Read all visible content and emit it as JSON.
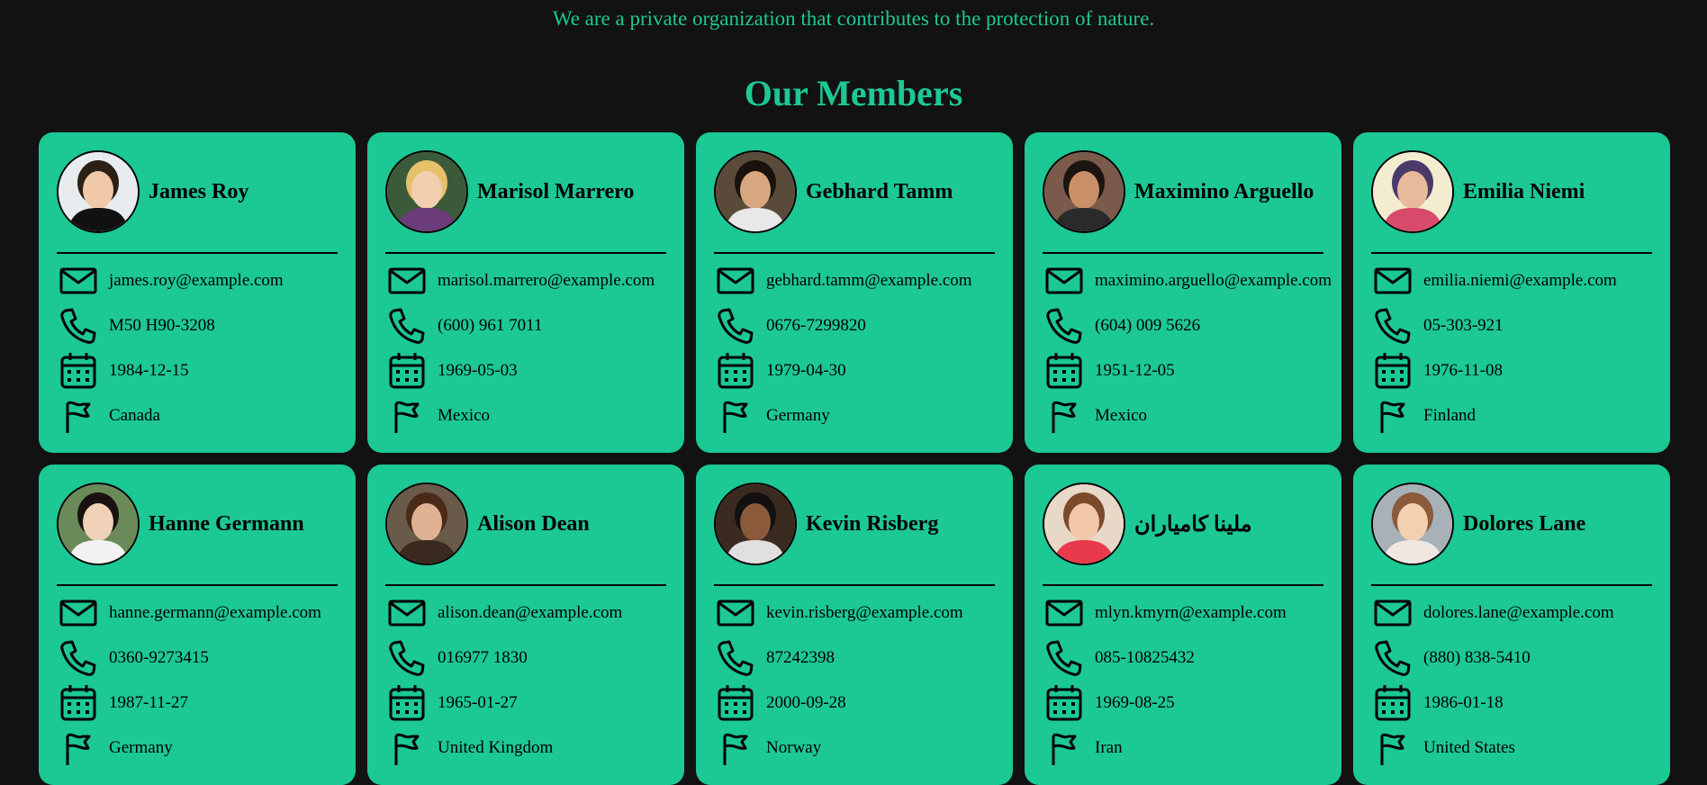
{
  "tagline": "We are a private organization that contributes to the protection of nature.",
  "heading": "Our Members",
  "colors": {
    "background": "#121212",
    "accent": "#1cc894",
    "text": "#000000"
  },
  "icons": {
    "email": "mail-icon",
    "phone": "phone-icon",
    "birthday": "calendar-icon",
    "country": "flag-icon"
  },
  "members": [
    {
      "name": "James Roy",
      "email": "james.roy@example.com",
      "phone": "M50 H90-3208",
      "birthday": "1984-12-15",
      "country": "Canada"
    },
    {
      "name": "Marisol Marrero",
      "email": "marisol.marrero@example.com",
      "phone": "(600) 961 7011",
      "birthday": "1969-05-03",
      "country": "Mexico"
    },
    {
      "name": "Gebhard Tamm",
      "email": "gebhard.tamm@example.com",
      "phone": "0676-7299820",
      "birthday": "1979-04-30",
      "country": "Germany"
    },
    {
      "name": "Maximino Arguello",
      "email": "maximino.arguello@example.com",
      "phone": "(604) 009 5626",
      "birthday": "1951-12-05",
      "country": "Mexico"
    },
    {
      "name": "Emilia Niemi",
      "email": "emilia.niemi@example.com",
      "phone": "05-303-921",
      "birthday": "1976-11-08",
      "country": "Finland"
    },
    {
      "name": "Hanne Germann",
      "email": "hanne.germann@example.com",
      "phone": "0360-9273415",
      "birthday": "1987-11-27",
      "country": "Germany"
    },
    {
      "name": "Alison Dean",
      "email": "alison.dean@example.com",
      "phone": "016977 1830",
      "birthday": "1965-01-27",
      "country": "United Kingdom"
    },
    {
      "name": "Kevin Risberg",
      "email": "kevin.risberg@example.com",
      "phone": "87242398",
      "birthday": "2000-09-28",
      "country": "Norway"
    },
    {
      "name": "ملینا کامیاران",
      "email": "mlyn.kmyrn@example.com",
      "phone": "085-10825432",
      "birthday": "1969-08-25",
      "country": "Iran"
    },
    {
      "name": "Dolores Lane",
      "email": "dolores.lane@example.com",
      "phone": "(880) 838-5410",
      "birthday": "1986-01-18",
      "country": "United States"
    }
  ]
}
